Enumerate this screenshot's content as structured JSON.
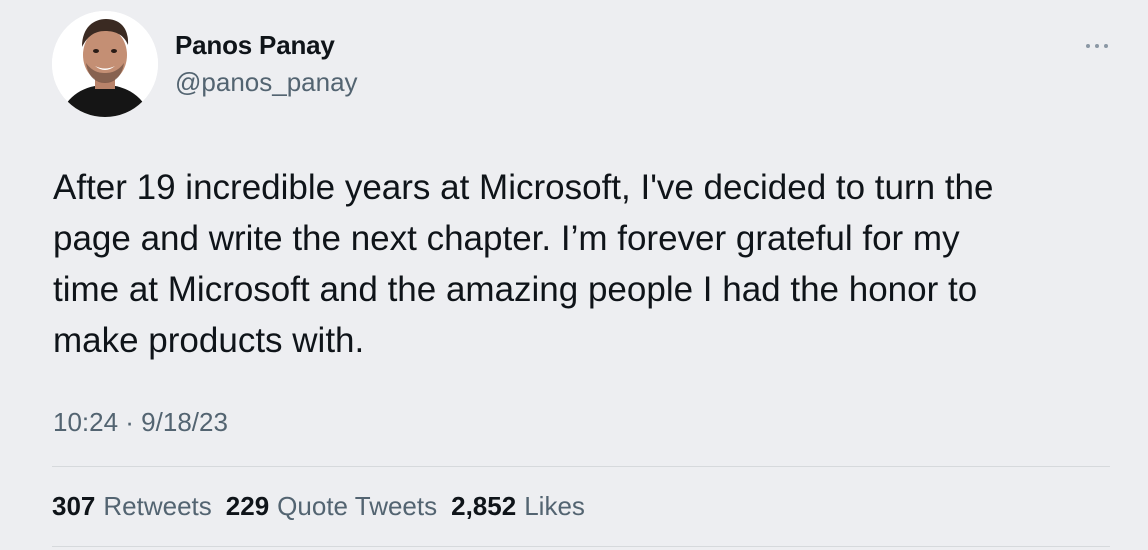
{
  "author": {
    "name": "Panos Panay",
    "handle": "@panos_panay",
    "avatar_icon": "user-avatar-photo"
  },
  "menu": {
    "more_icon": "more-horizontal-icon"
  },
  "tweet": {
    "text": "After 19 incredible years at Microsoft, I've decided to turn the\npage and write the next chapter. I’m forever grateful for my\ntime at Microsoft and the amazing people I had the honor to\nmake products with.",
    "timestamp": "10:24 · 9/18/23"
  },
  "stats": [
    {
      "count": "307",
      "label": "Retweets"
    },
    {
      "count": "229",
      "label": "Quote Tweets"
    },
    {
      "count": "2,852",
      "label": "Likes"
    }
  ],
  "colors": {
    "background": "#edeef1",
    "primary_text": "#0f1419",
    "secondary_text": "#536471",
    "divider": "#d6d9dc"
  }
}
